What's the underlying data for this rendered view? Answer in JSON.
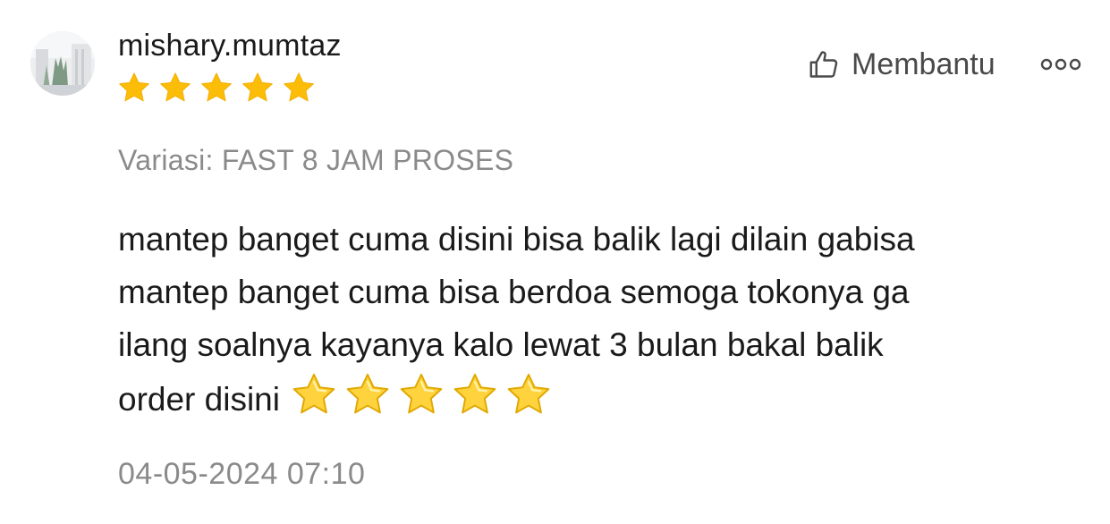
{
  "review": {
    "username": "mishary.mumtaz",
    "rating": 5,
    "helpful_label": "Membantu",
    "variation": "Variasi: FAST 8 JAM PROSES",
    "body_lines": [
      "mantep banget cuma disini bisa balik lagi dilain gabisa",
      "mantep banget cuma bisa berdoa semoga tokonya ga",
      "ilang soalnya kayanya kalo lewat 3 bulan bakal balik",
      "order disini"
    ],
    "emoji_star_count": 5,
    "timestamp": "04-05-2024 07:10"
  },
  "colors": {
    "star": "#fbbd08",
    "emoji_star": "#ffd33d",
    "text_primary": "#1a1a1a",
    "text_secondary": "#8a8a8a"
  },
  "icons": {
    "helpful": "thumbs-up-outline-icon",
    "more": "more-options-icon"
  }
}
